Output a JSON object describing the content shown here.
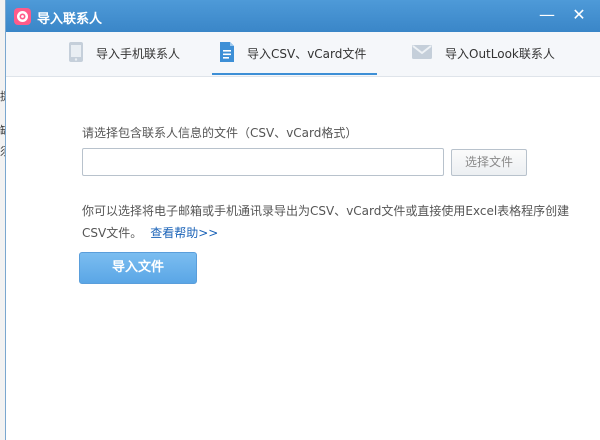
{
  "window": {
    "title": "导入联系人",
    "minimize_glyph": "—",
    "close_glyph": "✕"
  },
  "background": {
    "edge_chars": [
      "提",
      "缺",
      "须"
    ]
  },
  "tabs": [
    {
      "label": "导入手机联系人",
      "icon": "phone-icon"
    },
    {
      "label": "导入CSV、vCard文件",
      "icon": "file-icon",
      "active": true
    },
    {
      "label": "导入OutLook联系人",
      "icon": "mail-icon"
    }
  ],
  "form": {
    "prompt": "请选择包含联系人信息的文件（CSV、vCard格式）",
    "file_value": "",
    "choose_button": "选择文件"
  },
  "description": {
    "text": "你可以选择将电子邮箱或手机通讯录导出为CSV、vCard文件或直接使用Excel表格程序创建CSV文件。",
    "help_link": "查看帮助>>"
  },
  "import_button": "导入文件",
  "colors": {
    "titlebar": "#3a86c8",
    "accent": "#3d8fd6",
    "link": "#1b63b8",
    "primary_button": "#5aa6e6",
    "app_icon": "#ff5b8a"
  }
}
